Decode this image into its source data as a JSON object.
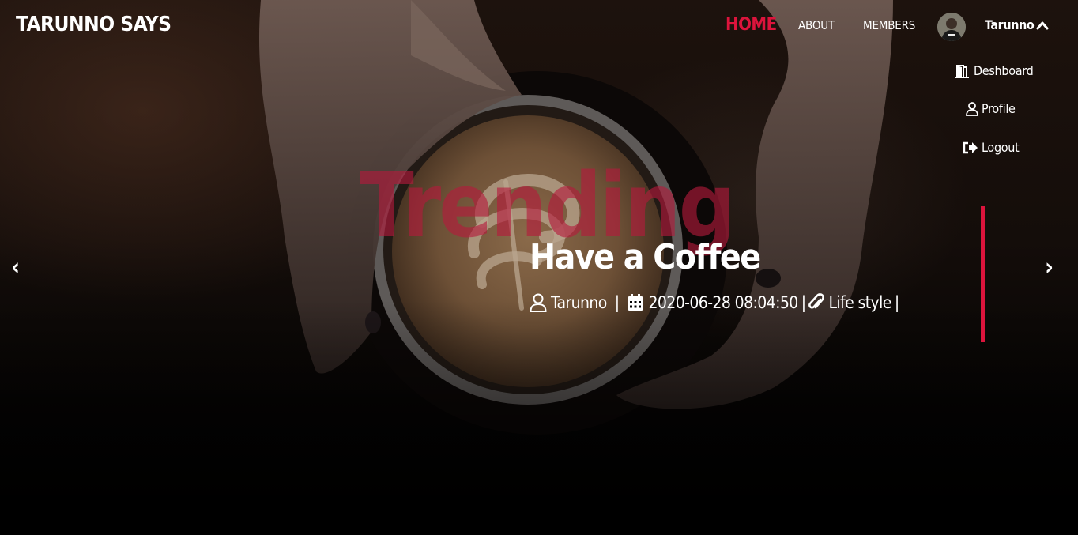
{
  "brand": {
    "name": "TARUNNO SAYS"
  },
  "nav": {
    "home": "HOME",
    "about": "ABOUT",
    "members": "MEMBERS"
  },
  "user": {
    "name": "Tarunno",
    "menu": {
      "dashboard": "Deshboard",
      "profile": "Profile",
      "logout": "Logout"
    }
  },
  "hero": {
    "watermark": "Trending",
    "title": "Have a Coffee",
    "meta": {
      "author": "Tarunno",
      "date": "2020-06-28 08:04:50",
      "category": "Life style",
      "sep1": "|",
      "sep2": "|",
      "sep3": "|"
    }
  },
  "carousel": {
    "prev": "‹",
    "next": "›"
  },
  "colors": {
    "accent": "#dc143c",
    "text": "#ffffff",
    "background": "#000000"
  },
  "icons": {
    "dashboard": "door-open-icon",
    "profile": "user-icon",
    "logout": "sign-out-icon",
    "author": "user-icon",
    "date": "calendar-icon",
    "category": "paperclip-icon",
    "user_toggle": "chevron-up-icon"
  }
}
